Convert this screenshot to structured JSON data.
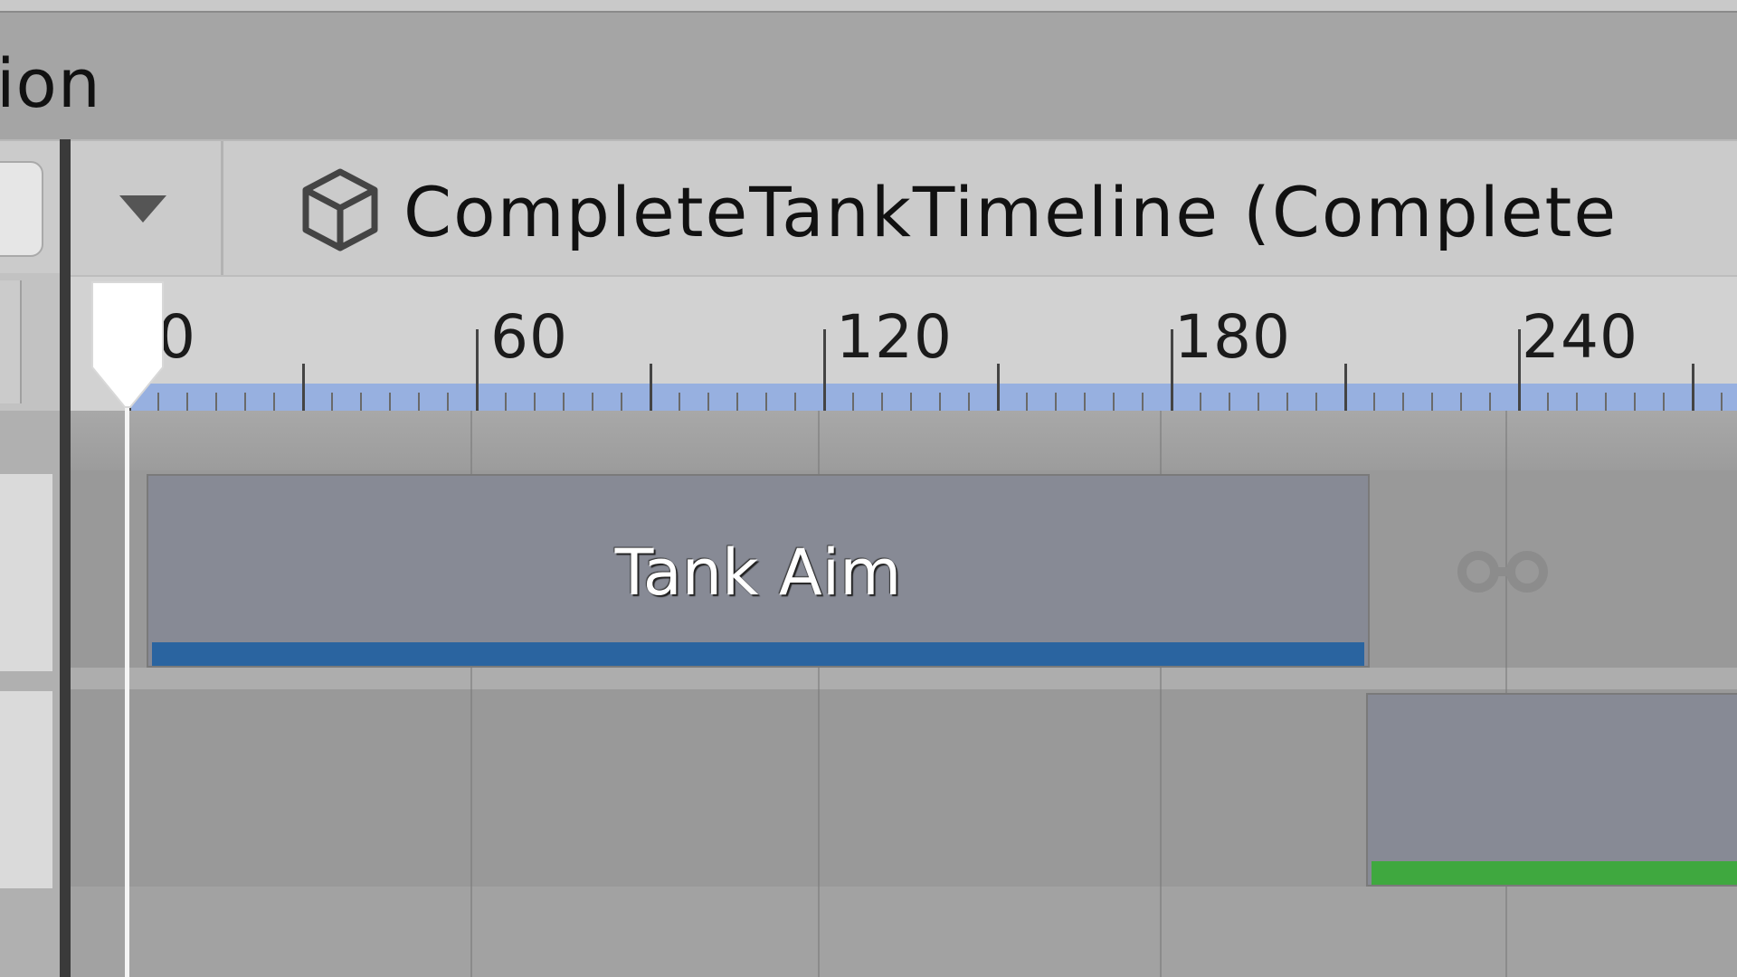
{
  "window": {
    "title_fragment": "ion"
  },
  "toolbar": {
    "dropdown_icon": "dropdown-triangle-icon",
    "asset_icon": "cube-icon",
    "asset_label": "CompleteTankTimeline (Complete"
  },
  "ruler": {
    "labels": [
      "0",
      "60",
      "120",
      "180",
      "240"
    ]
  },
  "tracks": [
    {
      "clips": [
        {
          "label": "Tank Aim",
          "accent": "#2a64a0"
        }
      ],
      "loop_icon": "loop-icon"
    },
    {
      "clips": [
        {
          "label": "",
          "accent": "#3fa83f"
        }
      ]
    }
  ],
  "colors": {
    "ruler_strip": "#97b0e0",
    "clip_body": "#878a95",
    "playhead": "#f5f5f5"
  }
}
